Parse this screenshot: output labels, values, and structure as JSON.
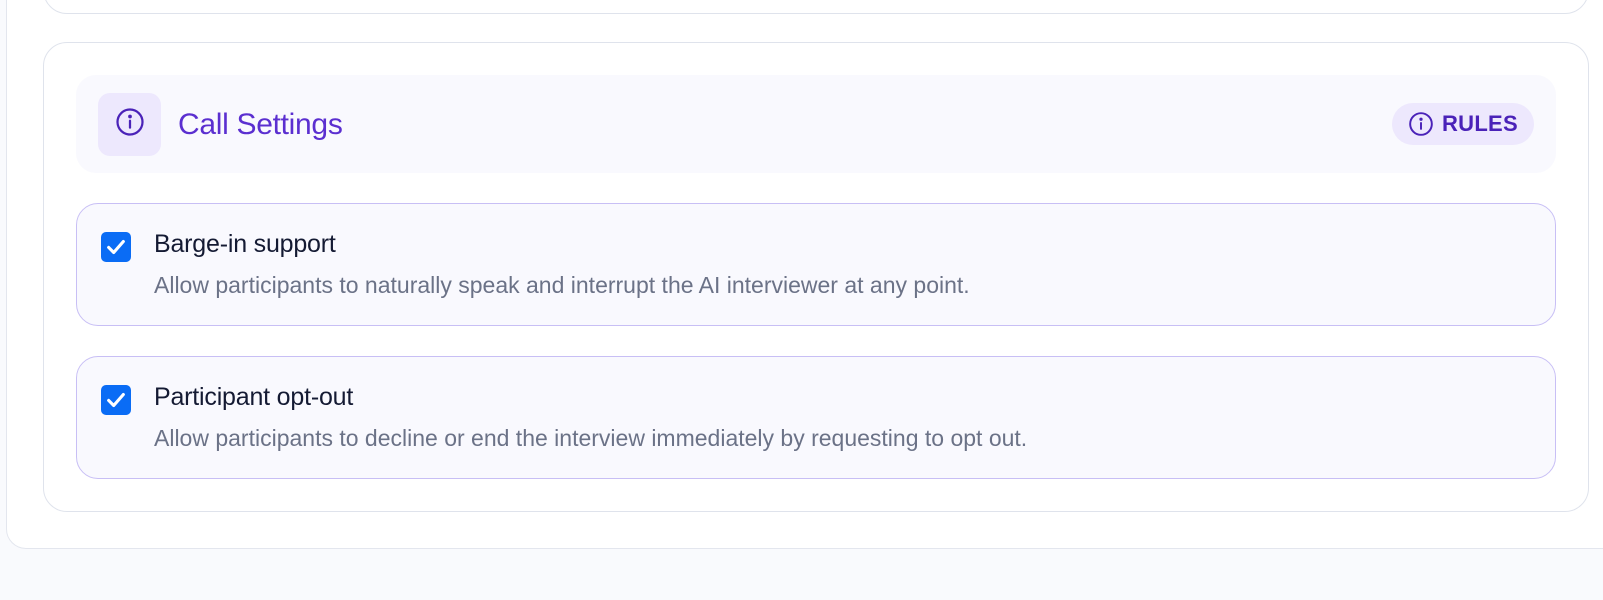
{
  "section": {
    "title": "Call Settings",
    "header_icon": "info-icon",
    "rules_label": "RULES",
    "rules_icon": "info-icon"
  },
  "options": [
    {
      "title": "Barge-in support",
      "description": "Allow participants to naturally speak and interrupt the AI interviewer at any point.",
      "checked": true
    },
    {
      "title": "Participant opt-out",
      "description": "Allow participants to decline or end the interview immediately by requesting to opt out.",
      "checked": true
    }
  ],
  "colors": {
    "accent": "#5b2fd0",
    "checkbox": "#0a6cf5",
    "option_border": "#c8bff5",
    "pill_bg": "#ede8fd"
  }
}
